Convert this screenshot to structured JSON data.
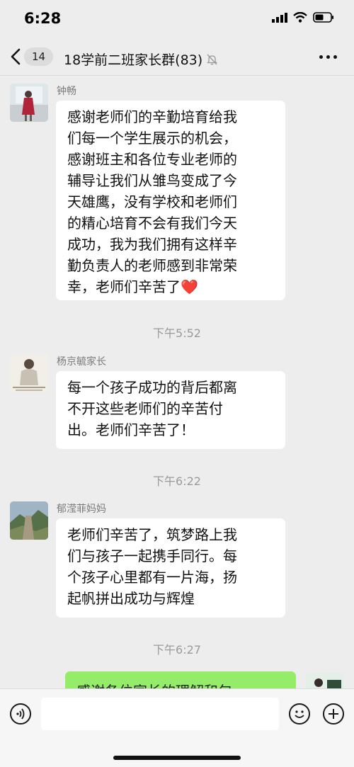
{
  "status_bar": {
    "time": "6:28"
  },
  "nav": {
    "unread_count": "14",
    "title": "18学前二班家长群(83)"
  },
  "messages": [
    {
      "sender": "钟畅",
      "lines": [
        "感谢老师们的辛勤培育给我",
        "们每一个学生展示的机会，",
        "感谢班主和各位专业老师的",
        "辅导让我们从雏鸟变成了今",
        "天雄鹰，没有学校和老师们",
        "的精心培育不会有我们今天",
        "成功，我为我们拥有这样辛",
        "勤负责人的老师感到非常荣",
        "幸，老师们辛苦了❤️"
      ]
    },
    {
      "sender": "杨京毓家长",
      "lines": [
        "每一个孩子成功的背后都离",
        "不开这些老师们的辛苦付",
        "出。老师们辛苦了！"
      ]
    },
    {
      "sender": "郁滢菲妈妈",
      "lines": [
        "老师们辛苦了，筑梦路上我",
        "们与孩子一起携手同行。每",
        "个孩子心里都有一片海，扬",
        "起帆拼出成功与辉煌"
      ]
    }
  ],
  "timestamps": [
    "下午5:52",
    "下午6:22",
    "下午6:27"
  ],
  "outgoing": {
    "text": "感谢各位家长的理解和包"
  },
  "colors": {
    "background": "#ededed",
    "bubble_in": "#ffffff",
    "bubble_out": "#95ec69"
  },
  "icons": [
    "signal-icon",
    "wifi-icon",
    "battery-icon",
    "back-chevron-icon",
    "mute-bell-icon",
    "more-icon",
    "voice-icon",
    "emoji-icon",
    "plus-icon"
  ]
}
